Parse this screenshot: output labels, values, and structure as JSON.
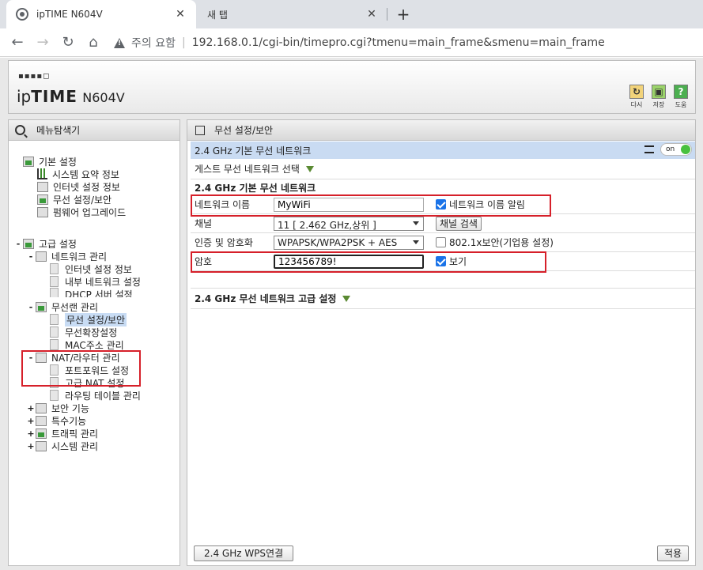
{
  "browser": {
    "active_tab": "ipTIME N604V",
    "new_tab": "새 탭",
    "close_glyph": "✕",
    "new_tab_glyph": "+",
    "not_secure": "주의 요함",
    "url": "192.168.0.1/cgi-bin/timepro.cgi?tmenu=main_frame&smenu=main_frame"
  },
  "header": {
    "dots": "▪▪▪▪◻",
    "brand_prefix": "ip",
    "brand_bold": "TIME",
    "model": "N604V",
    "buttons": [
      {
        "label": "다시",
        "glyph": "↻"
      },
      {
        "label": "저장",
        "glyph": "▣"
      },
      {
        "label": "도움",
        "glyph": "?"
      }
    ]
  },
  "sidebar": {
    "title": "메뉴탐색기",
    "basic": "기본 설정",
    "basic_items": [
      "시스템 요약 정보",
      "인터넷 설정 정보",
      "무선 설정/보안",
      "펌웨어 업그레이드"
    ],
    "advanced": "고급 설정",
    "network": "네트워크 관리",
    "network_items": [
      "인터넷 설정 정보",
      "내부 네트워크 설정",
      "DHCP 서버 설정"
    ],
    "wireless": "무선랜 관리",
    "wireless_items": [
      "무선 설정/보안",
      "무선확장설정",
      "MAC주소 관리"
    ],
    "nat": "NAT/라우터 관리",
    "nat_items": [
      "포트포워드 설정",
      "고급 NAT 설정",
      "라우팅 테이블 관리"
    ],
    "others": [
      "보안 기능",
      "특수기능",
      "트래픽 관리",
      "시스템 관리"
    ],
    "toggle_minus": "-",
    "toggle_plus": "+"
  },
  "main": {
    "title": "무선 설정/보안",
    "section": "2.4 GHz 기본 무선 네트워크",
    "toggle": "on",
    "guest": "게스트 무선 네트워크 선택",
    "subsection": "2.4 GHz 기본 무선 네트워크",
    "ssid_label": "네트워크 이름",
    "ssid_value": "MyWiFi",
    "ssid_broadcast": "네트워크 이름 알림",
    "channel_label": "채널",
    "channel_value": "11 [ 2.462 GHz,상위 ]",
    "channel_search": "채널 검색",
    "auth_label": "인증 및 암호화",
    "auth_value": "WPAPSK/WPA2PSK + AES",
    "dot1x": "802.1x보안(기업용 설정)",
    "pw_label": "암호",
    "pw_value": "123456789!",
    "show": "보기",
    "advanced": "2.4 GHz 무선 네트워크 고급 설정",
    "wps_button": "2.4 GHz WPS연결",
    "apply_button": "적용"
  }
}
